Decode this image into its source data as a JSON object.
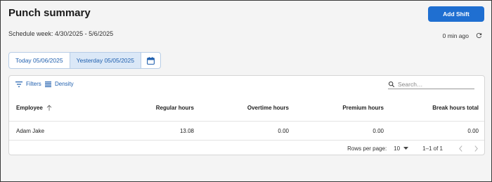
{
  "page": {
    "title": "Punch summary"
  },
  "actions": {
    "add_shift_label": "Add Shift"
  },
  "schedule": {
    "week_text": "Schedule week: 4/30/2025 - 5/6/2025"
  },
  "refresh": {
    "status_text": "0 min ago"
  },
  "day_toggle": {
    "today_label": "Today 05/06/2025",
    "yesterday_label": "Yesterday 05/05/2025",
    "selected": "yesterday"
  },
  "toolbar": {
    "filters_label": "Filters",
    "density_label": "Density",
    "search_placeholder": "Search…"
  },
  "table": {
    "columns": {
      "employee": "Employee",
      "regular": "Regular hours",
      "overtime": "Overtime hours",
      "premium": "Premium hours",
      "break": "Break hours total"
    },
    "rows": [
      {
        "employee": "Adam Jake",
        "regular": "13.08",
        "overtime": "0.00",
        "premium": "0.00",
        "break": "0.00"
      }
    ]
  },
  "pagination": {
    "rows_per_page_label": "Rows per page:",
    "rows_per_page_value": "10",
    "range_text": "1–1 of 1"
  },
  "colors": {
    "accent": "#1f6fd1",
    "link": "#1f5fae",
    "selected_bg": "#dbe8f7"
  }
}
